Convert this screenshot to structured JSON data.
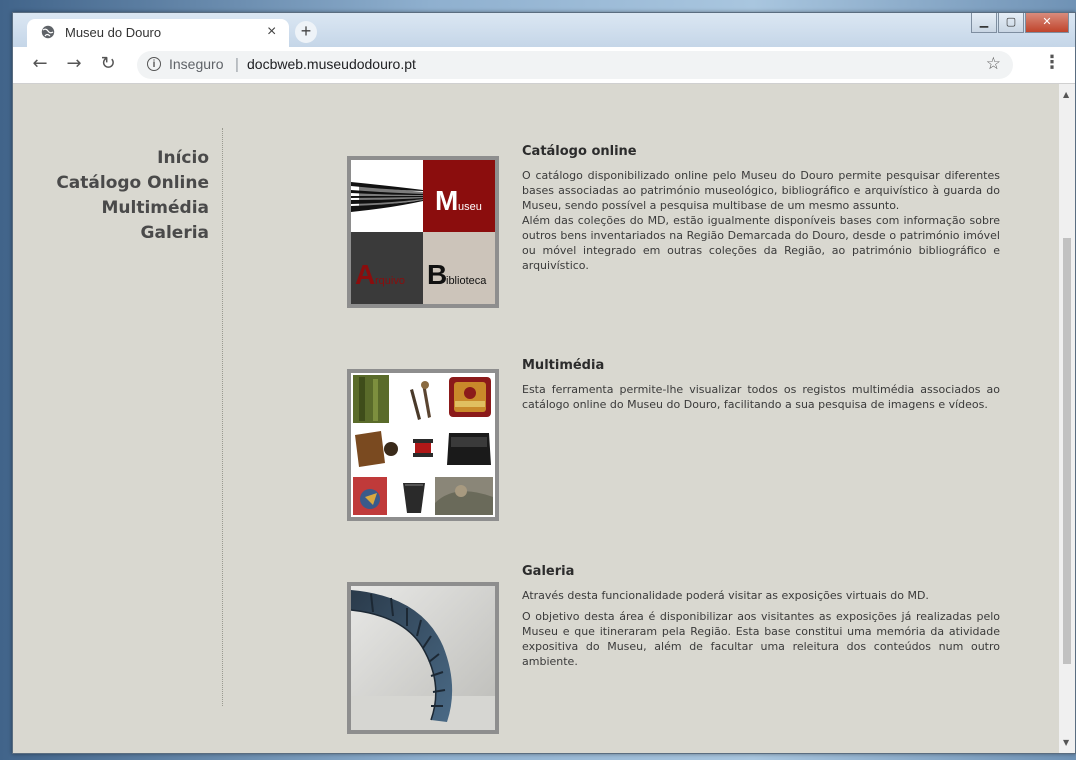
{
  "browser": {
    "tab_title": "Museu do Douro",
    "tab_close": "×",
    "new_tab": "+",
    "security_label": "Inseguro",
    "url": "docbweb.museudodouro.pt",
    "back_icon": "arrow-left-icon",
    "forward_icon": "arrow-right-icon",
    "reload_icon": "reload-icon",
    "bookmark_icon": "star-icon",
    "menu_icon": "kebab-menu-icon"
  },
  "nav": {
    "items": [
      "Início",
      "Catálogo Online",
      "Multimédia",
      "Galeria"
    ]
  },
  "sections": [
    {
      "title": "Catálogo online",
      "paragraphs": [
        "O catálogo disponibilizado online pelo Museu do Douro permite pesquisar diferentes bases associadas ao património museológico, bibliográfico e arquivístico à guarda do Museu, sendo possível a pesquisa multibase de um mesmo assunto.",
        "Além das coleções do MD, estão igualmente disponíveis bases com informação sobre outros bens inventariados na Região Demarcada do Douro, desde o património imóvel ou móvel integrado em outras coleções da Região, ao património bibliográfico e arquivístico."
      ],
      "image_labels": {
        "museu_initial": "M",
        "museu_rest": "useu",
        "arquivo_initial": "A",
        "arquivo_rest": "rquivo",
        "biblioteca_initial": "B",
        "biblioteca_rest": "iblioteca"
      }
    },
    {
      "title": "Multimédia",
      "paragraphs": [
        "Esta ferramenta permite-lhe visualizar todos os registos multimédia associados ao catálogo online do Museu do Douro, facilitando a sua pesquisa de imagens e vídeos."
      ]
    },
    {
      "title": "Galeria",
      "paragraphs": [
        "Através desta funcionalidade poderá visitar as exposições virtuais do MD.",
        "O objetivo desta área é disponibilizar aos visitantes as exposições já realizadas pelo Museu e que itineraram pela Região. Esta base constitui uma memória da atividade expositiva do Museu, além de facultar uma releitura dos conteúdos num outro ambiente."
      ]
    }
  ],
  "colors": {
    "page_bg": "#d9d8d0",
    "museu_red": "#8b0d0d",
    "arquivo_dark": "#3a3a3a",
    "biblioteca_beige": "#ccc4ba"
  }
}
